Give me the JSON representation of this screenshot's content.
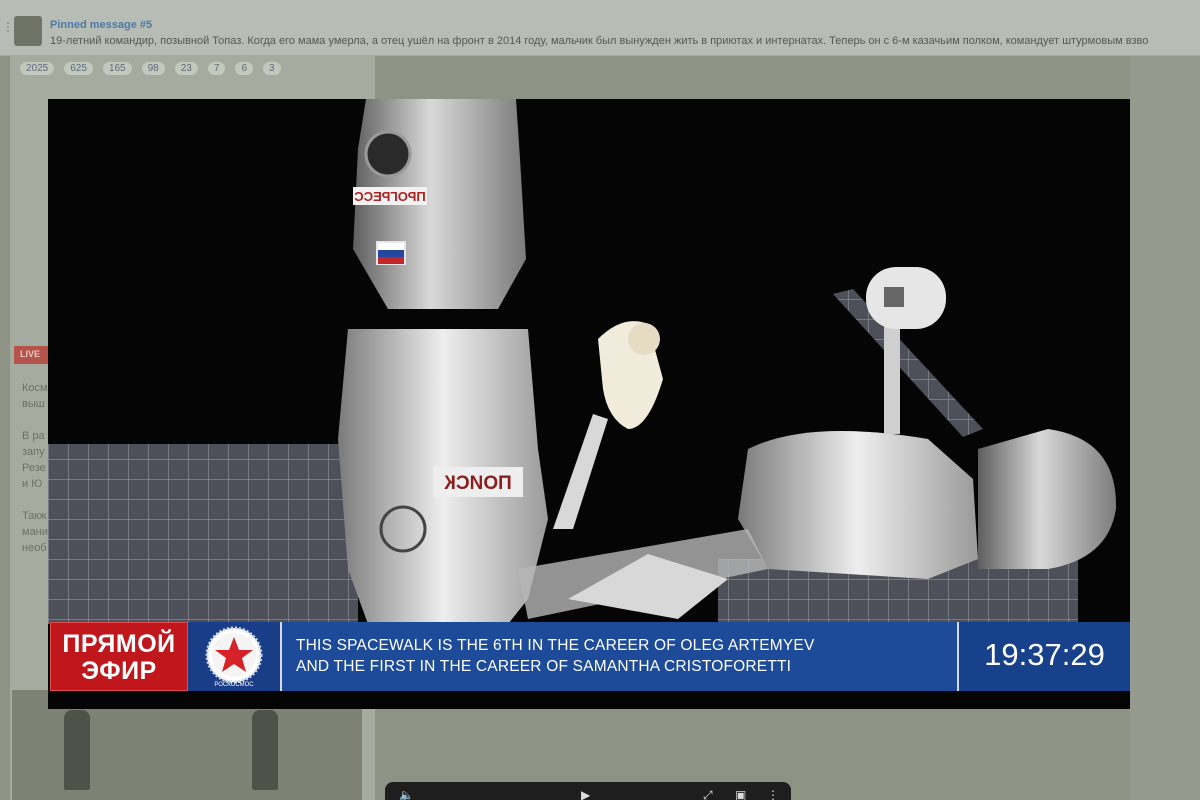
{
  "pinned": {
    "title": "Pinned message #5",
    "text": "19-летний командир, позывной Топаз. Когда его мама умерла, а отец ушёл на фронт в 2014 году, мальчик был вынужден жить в приютах и интернатах. Теперь он с 6-м казачьим полком, командует штурмовым взво"
  },
  "reactions": [
    "2025",
    "625",
    "165",
    "98",
    "23",
    "7",
    "6",
    "3"
  ],
  "background": {
    "live_tag": "LIVE",
    "side_words": [
      "Косм",
      "выш",
      "В ра",
      "запу",
      "Резе",
      "и Ю",
      "Такж",
      "мани",
      "необ"
    ]
  },
  "video": {
    "module_label_top": "ПРОГРЕСС",
    "module_label_mid": "ПОИСК",
    "broadcast": {
      "live_label_line1": "ПРЯМОЙ",
      "live_label_line2": "ЭФИР",
      "logo_text": "РОСКОСМОС",
      "ticker_line1": "THIS SPACEWALK IS THE 6th IN THE CAREER OF OLEG ARTEMYEV",
      "ticker_line2": "AND THE FIRST IN THE CAREER OF SAMANTHA CRISTOFORETTI",
      "clock": "19:37:29"
    }
  },
  "colors": {
    "live_red": "#c0171d",
    "broadcast_blue": "#1d4b9a",
    "space_black": "#050505"
  },
  "icons": [
    "volume-icon",
    "play-icon",
    "fullscreen-icon",
    "pip-icon",
    "more-icon"
  ]
}
